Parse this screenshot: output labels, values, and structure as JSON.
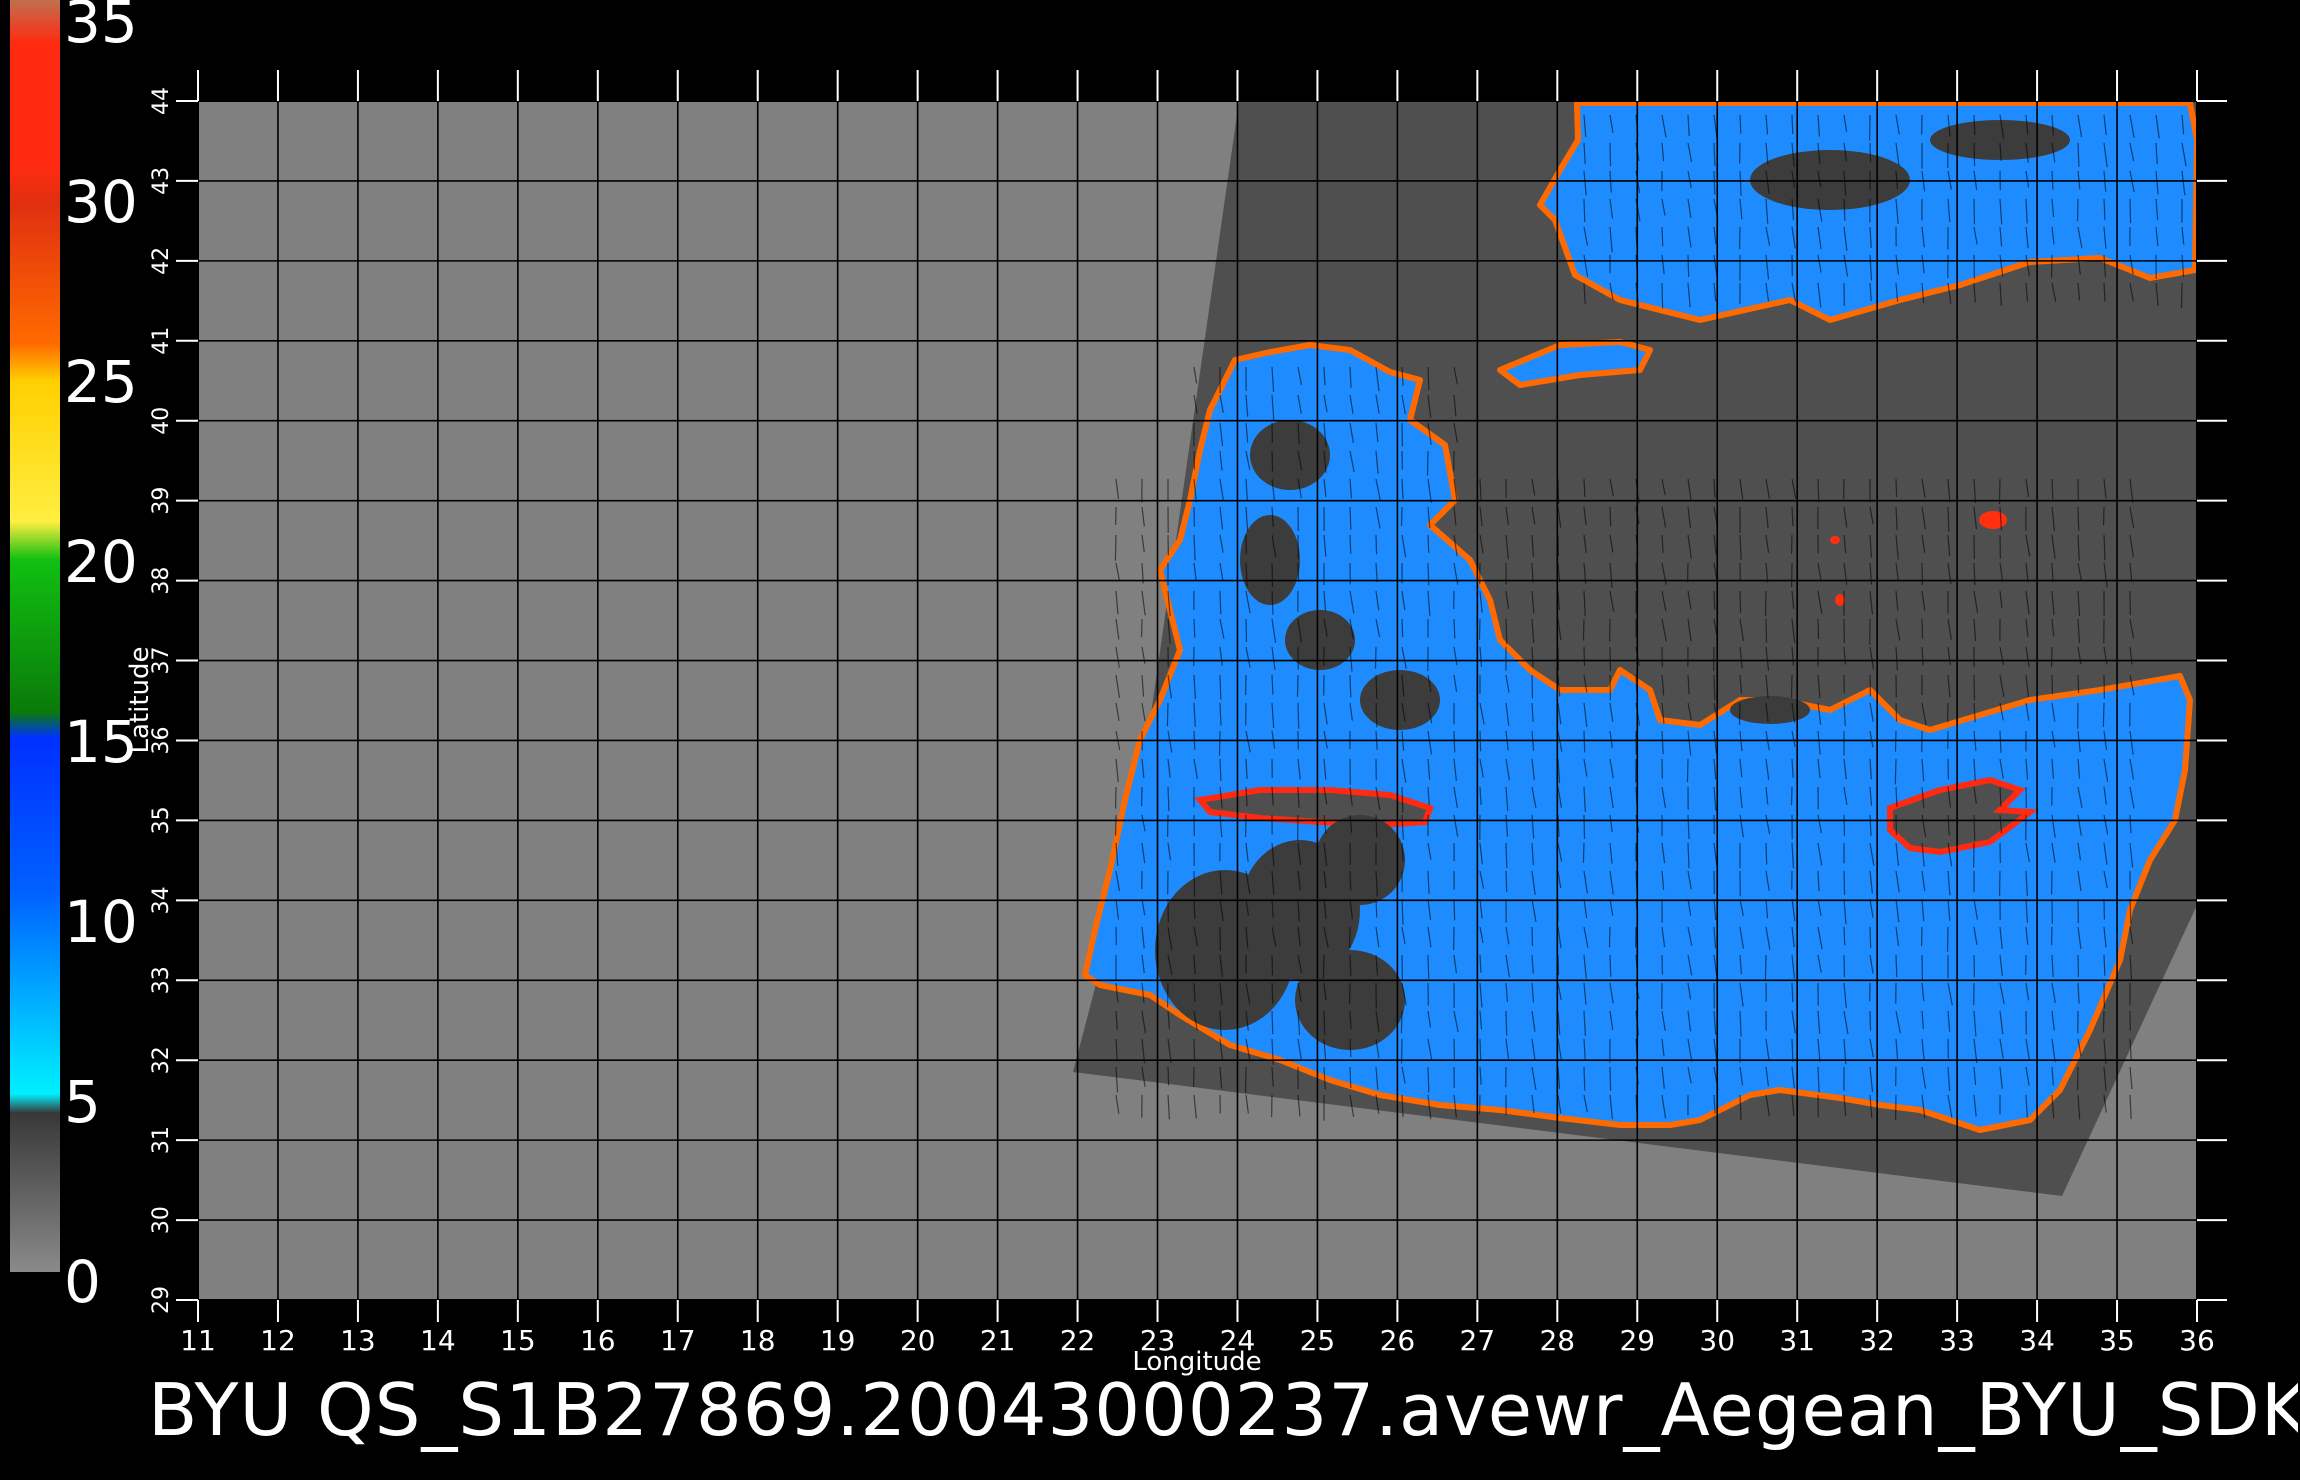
{
  "caption": "BYU  QS_S1B27869.20043000237.avewr_Aegean_BYU_SDK",
  "map": {
    "xlabel": "Longitude",
    "ylabel": "Latitude",
    "lon_range": [
      11,
      36
    ],
    "lat_range": [
      29,
      44
    ],
    "lon_ticks": [
      "11",
      "12",
      "13",
      "14",
      "15",
      "16",
      "17",
      "18",
      "19",
      "20",
      "21",
      "22",
      "23",
      "24",
      "25",
      "26",
      "27",
      "28",
      "29",
      "30",
      "31",
      "32",
      "33",
      "34",
      "35",
      "36"
    ],
    "lat_ticks": [
      "29",
      "30",
      "31",
      "32",
      "33",
      "34",
      "35",
      "36",
      "37",
      "38",
      "39",
      "40",
      "41",
      "42",
      "43",
      "44"
    ],
    "grid": true,
    "background_color": "#808080",
    "swath_color": "#4f4f4f",
    "land_color": "#4f4f4f",
    "sea_color": "#1e8cff"
  },
  "colorbar": {
    "labels": [
      "35",
      "30",
      "25",
      "20",
      "15",
      "10",
      "5",
      "0"
    ],
    "colors": [
      "#c07050",
      "#ff2a10",
      "#ff6a00",
      "#ffd000",
      "#11a611",
      "#0050ff",
      "#00ccff",
      "#404040",
      "#8a8a8a"
    ]
  }
}
